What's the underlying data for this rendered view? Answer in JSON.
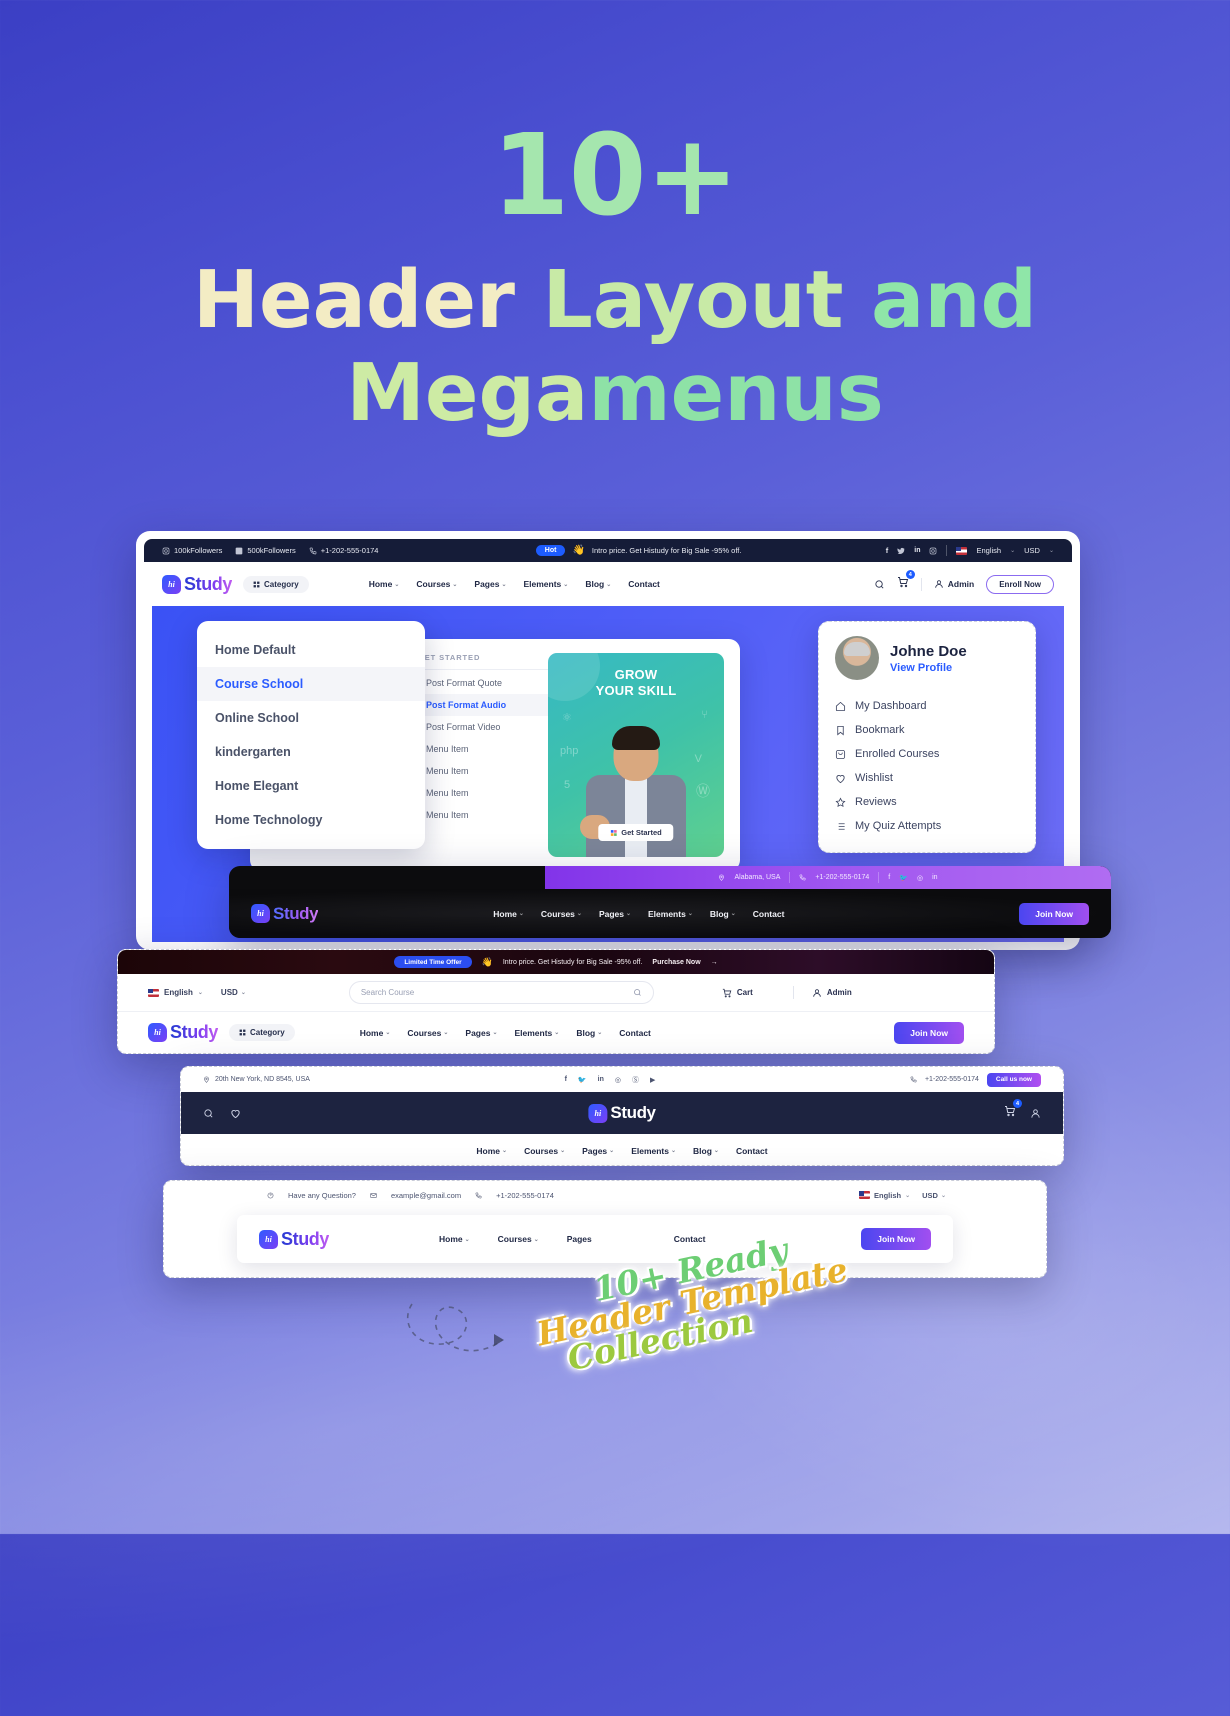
{
  "hero": {
    "count": "10+",
    "line2_a": "Header ",
    "line2_b": "Layout",
    "line2_c": " and",
    "line3_a": "Mega",
    "line3_b": "menus"
  },
  "brand": {
    "mark": "hi",
    "name": "Study"
  },
  "header1": {
    "topbar": {
      "instagram_followers": "100kFollowers",
      "facebook_followers": "500kFollowers",
      "phone": "+1-202-555-0174",
      "badge": "Hot",
      "promo": "Intro price. Get Histudy for Big Sale -95% off.",
      "language": "English",
      "currency": "USD"
    },
    "category_label": "Category",
    "nav": [
      "Home",
      "Courses",
      "Pages",
      "Elements",
      "Blog",
      "Contact"
    ],
    "cart_count": "4",
    "account_label": "Admin",
    "cta": "Enroll Now"
  },
  "megamenu": {
    "home_items": [
      "Home Default",
      "Course School",
      "Online School",
      "kindergarten",
      "Home Elegant",
      "Home Technology"
    ],
    "home_active": "Course School",
    "section_title": "GET STARTED",
    "post_items": [
      "Post Format Quote",
      "Post Format Audio",
      "Post Format Video",
      "Menu Item",
      "Menu Item",
      "Menu Item",
      "Menu Item"
    ],
    "post_active": "Post Format Audio",
    "promo": {
      "line1": "GROW",
      "line2": "YOUR SKILL",
      "button": "Get Started"
    }
  },
  "profile": {
    "name": "Johne Doe",
    "view_profile": "View Profile",
    "items": [
      "My Dashboard",
      "Bookmark",
      "Enrolled Courses",
      "Wishlist",
      "Reviews",
      "My Quiz Attempts"
    ]
  },
  "header2": {
    "location": "Alabama, USA",
    "phone": "+1-202-555-0174",
    "nav": [
      "Home",
      "Courses",
      "Pages",
      "Elements",
      "Blog",
      "Contact"
    ],
    "cta": "Join Now"
  },
  "header3": {
    "badge": "Limited Time Offer",
    "promo": "Intro price. Get Histudy for Big Sale -95% off.",
    "purchase": "Purchase Now",
    "language": "English",
    "currency": "USD",
    "search_placeholder": "Search Course",
    "cart_label": "Cart",
    "account_label": "Admin",
    "category_label": "Category",
    "nav": [
      "Home",
      "Courses",
      "Pages",
      "Elements",
      "Blog",
      "Contact"
    ],
    "cta": "Join Now"
  },
  "header4": {
    "address": "20th New York, ND 8545, USA",
    "phone": "+1-202-555-0174",
    "call_cta": "Call us now",
    "cart_count": "4",
    "nav": [
      "Home",
      "Courses",
      "Pages",
      "Elements",
      "Blog",
      "Contact"
    ]
  },
  "header5": {
    "question": "Have any Question?",
    "email": "example@gmail.com",
    "phone": "+1-202-555-0174",
    "language": "English",
    "currency": "USD",
    "nav": [
      "Home",
      "Courses",
      "Pages",
      "Contact"
    ],
    "cta": "Join Now"
  },
  "handwriting": {
    "line1": "10+ Ready",
    "line2": "Header Template",
    "line3": "Collection"
  },
  "colors": {
    "accent_blue": "#2b5cff",
    "purple": "#8234e9",
    "dark_navy": "#1d2340",
    "hero_green": "#a5e6ae",
    "hero_cream": "#f3ecc4"
  }
}
